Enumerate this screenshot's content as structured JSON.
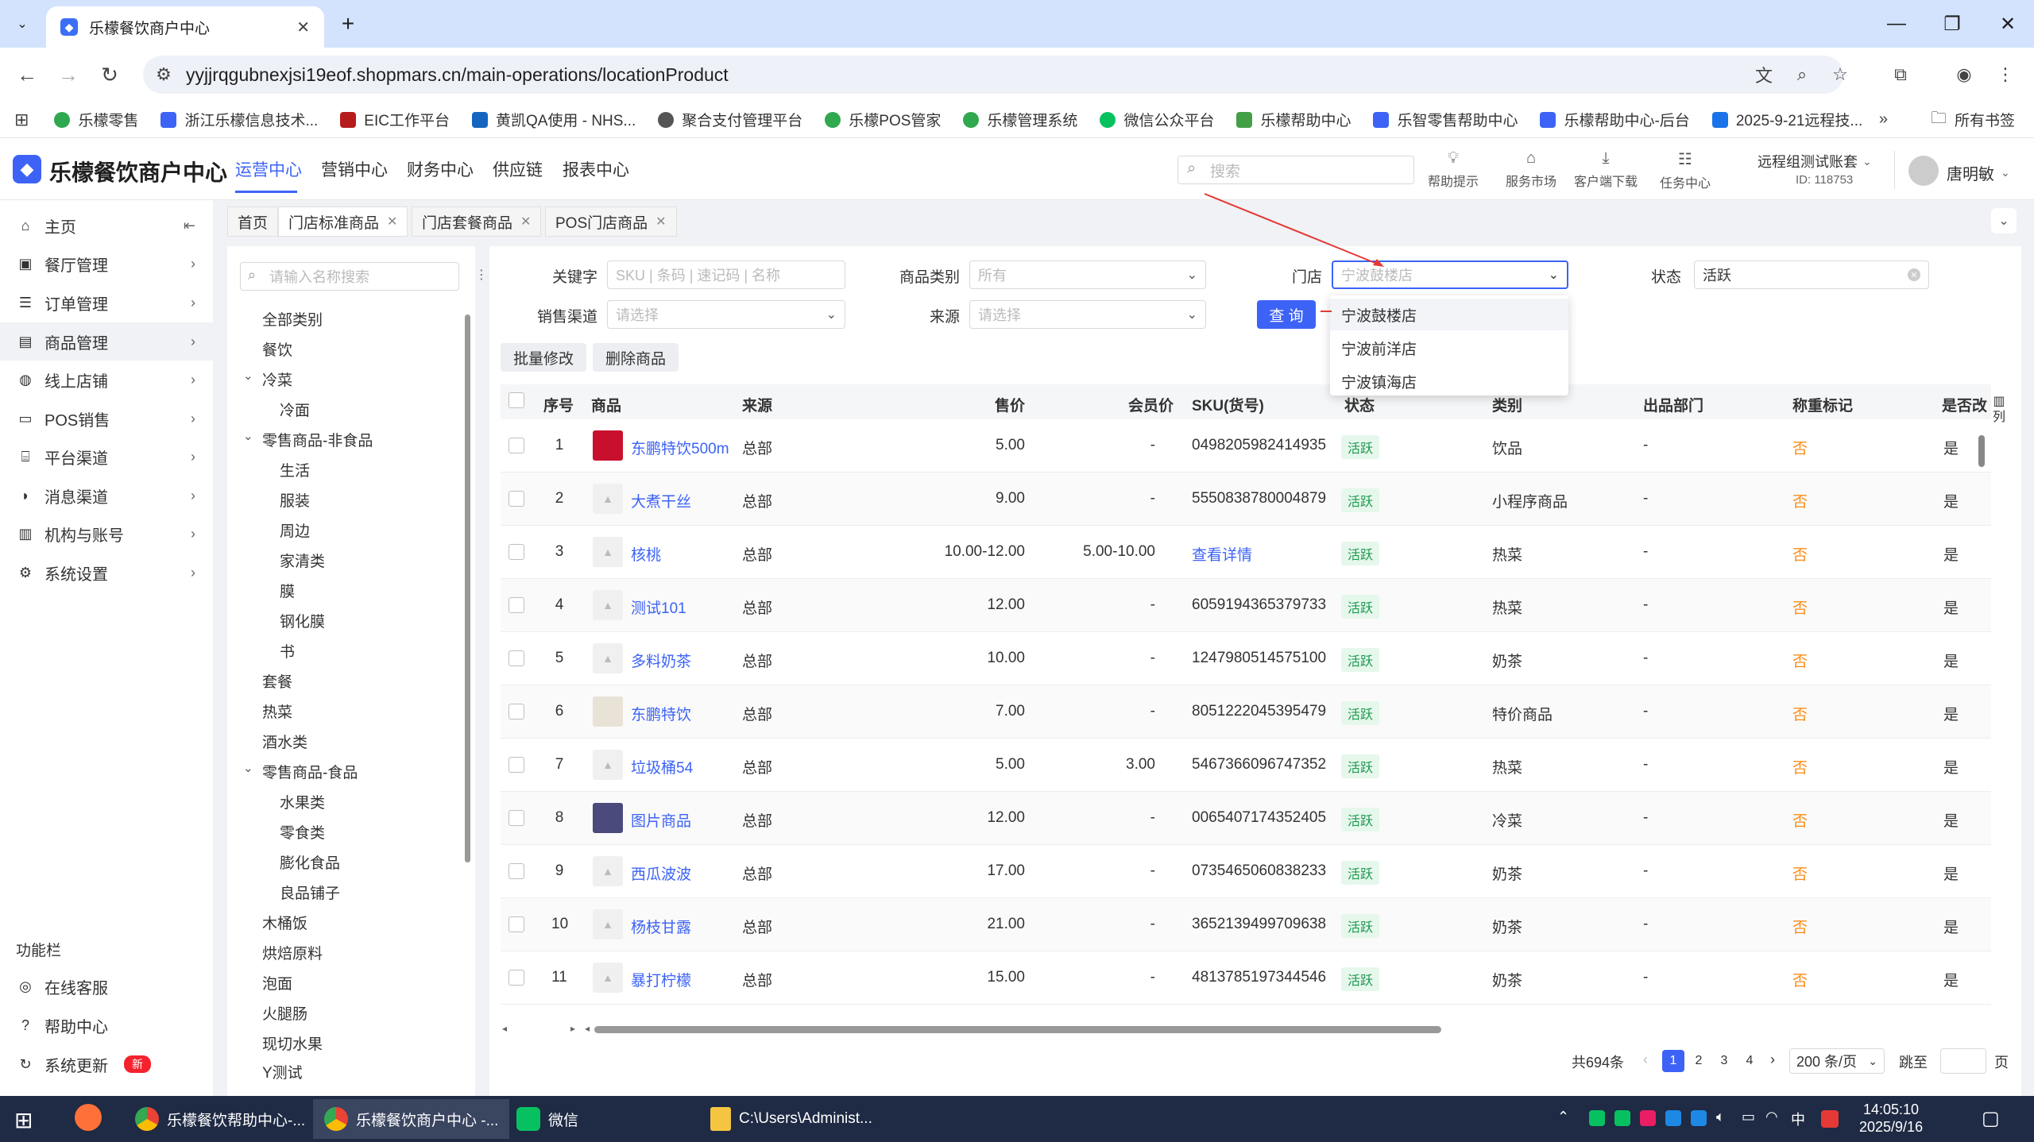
{
  "browser": {
    "tab_title": "乐檬餐饮商户中心",
    "url": "yyjjrqgubnexjsi19eof.shopmars.cn/main-operations/locationProduct",
    "bookmarks": [
      "乐檬零售",
      "浙江乐檬信息技术...",
      "EIC工作平台",
      "黄凯QA使用 - NHS...",
      "聚合支付管理平台",
      "乐檬POS管家",
      "乐檬管理系统",
      "微信公众平台",
      "乐檬帮助中心",
      "乐智零售帮助中心",
      "乐檬帮助中心-后台",
      "2025-9-21远程技...",
      "所有书签"
    ]
  },
  "header": {
    "logo_text": "乐檬餐饮商户中心",
    "nav": [
      "运营中心",
      "营销中心",
      "财务中心",
      "供应链",
      "报表中心"
    ],
    "search_placeholder": "搜索",
    "tools": [
      "帮助提示",
      "服务市场",
      "客户端下载",
      "任务中心"
    ],
    "account_name": "远程组测试账套",
    "account_id": "ID: 118753",
    "username": "唐明敏"
  },
  "sidebar": {
    "items": [
      "主页",
      "餐厅管理",
      "订单管理",
      "商品管理",
      "线上店铺",
      "POS销售",
      "平台渠道",
      "消息渠道",
      "机构与账号",
      "系统设置"
    ],
    "func_title": "功能栏",
    "func_items": [
      "在线客服",
      "帮助中心",
      "系统更新"
    ],
    "new_badge": "新"
  },
  "page_tabs": [
    "首页",
    "门店标准商品",
    "门店套餐商品",
    "POS门店商品"
  ],
  "category": {
    "search_placeholder": "请输入名称搜索",
    "items": [
      "全部类别",
      "餐饮",
      "冷菜",
      "冷面",
      "零售商品-非食品",
      "生活",
      "服装",
      "周边",
      "家清类",
      "膜",
      "钢化膜",
      "书",
      "套餐",
      "热菜",
      "酒水类",
      "零售商品-食品",
      "水果类",
      "零食类",
      "膨化食品",
      "良品铺子",
      "木桶饭",
      "烘焙原料",
      "泡面",
      "火腿肠",
      "现切水果",
      "Y测试"
    ]
  },
  "filters": {
    "keyword_label": "关键字",
    "keyword_placeholder": "SKU | 条码 | 速记码 | 名称",
    "category_label": "商品类别",
    "category_value": "所有",
    "store_label": "门店",
    "store_placeholder": "宁波鼓楼店",
    "status_label": "状态",
    "status_value": "活跃",
    "channel_label": "销售渠道",
    "channel_placeholder": "请选择",
    "source_label": "来源",
    "source_placeholder": "请选择",
    "query_button": "查 询",
    "batch_edit": "批量修改",
    "delete_goods": "删除商品"
  },
  "store_dropdown": [
    "宁波鼓楼店",
    "宁波前洋店",
    "宁波镇海店"
  ],
  "table": {
    "columns": [
      "序号",
      "商品",
      "来源",
      "售价",
      "会员价",
      "SKU(货号)",
      "状态",
      "类别",
      "出品部门",
      "称重标记",
      "是否改"
    ],
    "col_setting": "列",
    "rows": [
      {
        "no": "1",
        "name": "东鹏特饮500m",
        "source": "总部",
        "price": "5.00",
        "member": "-",
        "sku": "0498205982414935",
        "status": "活跃",
        "cat": "饮品",
        "dept": "-",
        "weigh": "否",
        "change": "是"
      },
      {
        "no": "2",
        "name": "大煮干丝",
        "source": "总部",
        "price": "9.00",
        "member": "-",
        "sku": "5550838780004879",
        "status": "活跃",
        "cat": "小程序商品",
        "dept": "-",
        "weigh": "否",
        "change": "是"
      },
      {
        "no": "3",
        "name": "核桃",
        "source": "总部",
        "price": "10.00-12.00",
        "member": "5.00-10.00",
        "sku": "查看详情",
        "status": "活跃",
        "cat": "热菜",
        "dept": "-",
        "weigh": "否",
        "change": "是"
      },
      {
        "no": "4",
        "name": "测试101",
        "source": "总部",
        "price": "12.00",
        "member": "-",
        "sku": "6059194365379733",
        "status": "活跃",
        "cat": "热菜",
        "dept": "-",
        "weigh": "否",
        "change": "是"
      },
      {
        "no": "5",
        "name": "多料奶茶",
        "source": "总部",
        "price": "10.00",
        "member": "-",
        "sku": "1247980514575100",
        "status": "活跃",
        "cat": "奶茶",
        "dept": "-",
        "weigh": "否",
        "change": "是"
      },
      {
        "no": "6",
        "name": "东鹏特饮",
        "source": "总部",
        "price": "7.00",
        "member": "-",
        "sku": "8051222045395479",
        "status": "活跃",
        "cat": "特价商品",
        "dept": "-",
        "weigh": "否",
        "change": "是"
      },
      {
        "no": "7",
        "name": "垃圾桶54",
        "source": "总部",
        "price": "5.00",
        "member": "3.00",
        "sku": "5467366096747352",
        "status": "活跃",
        "cat": "热菜",
        "dept": "-",
        "weigh": "否",
        "change": "是"
      },
      {
        "no": "8",
        "name": "图片商品",
        "source": "总部",
        "price": "12.00",
        "member": "-",
        "sku": "0065407174352405",
        "status": "活跃",
        "cat": "冷菜",
        "dept": "-",
        "weigh": "否",
        "change": "是"
      },
      {
        "no": "9",
        "name": "西瓜波波",
        "source": "总部",
        "price": "17.00",
        "member": "-",
        "sku": "0735465060838233",
        "status": "活跃",
        "cat": "奶茶",
        "dept": "-",
        "weigh": "否",
        "change": "是"
      },
      {
        "no": "10",
        "name": "杨枝甘露",
        "source": "总部",
        "price": "21.00",
        "member": "-",
        "sku": "3652139499709638",
        "status": "活跃",
        "cat": "奶茶",
        "dept": "-",
        "weigh": "否",
        "change": "是"
      },
      {
        "no": "11",
        "name": "暴打柠檬",
        "source": "总部",
        "price": "15.00",
        "member": "-",
        "sku": "4813785197344546",
        "status": "活跃",
        "cat": "奶茶",
        "dept": "-",
        "weigh": "否",
        "change": "是"
      }
    ]
  },
  "pagination": {
    "total": "共694条",
    "pages": [
      "1",
      "2",
      "3",
      "4"
    ],
    "page_size": "200 条/页",
    "jump_label": "跳至",
    "page_unit": "页"
  },
  "taskbar": {
    "apps": [
      "乐檬餐饮帮助中心-...",
      "乐檬餐饮商户中心 -...",
      "微信",
      "C:\\Users\\Administ..."
    ],
    "time": "14:05:10",
    "date": "2025/9/16",
    "ime": "中"
  },
  "colors": {
    "accent": "#3d63f6",
    "active_tag": "#1e9a4f",
    "warning": "#fa8c16"
  }
}
